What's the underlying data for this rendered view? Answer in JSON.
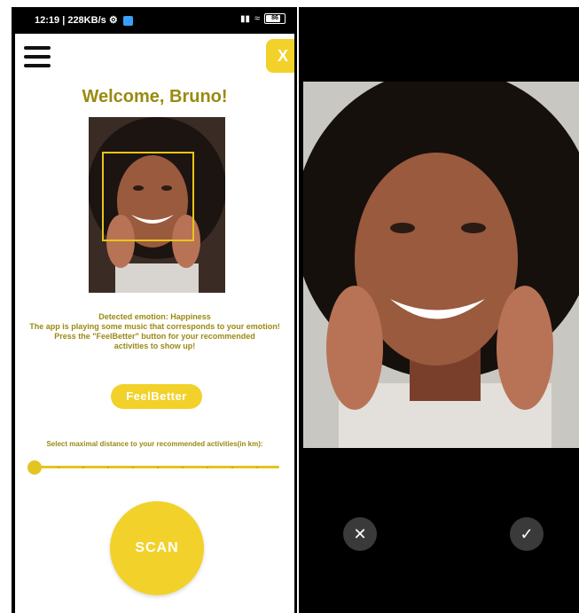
{
  "left_screen": {
    "status_bar": {
      "time": "12:19 | 228KB/s",
      "battery": "86"
    },
    "welcome": "Welcome, Bruno!",
    "close_label": "X",
    "emotion_lines": [
      "Detected emotion: Happiness",
      "The app is playing some music that corresponds to your emotion!",
      "Press the \"FeelBetter\" button for your recommended",
      "activities to show up!"
    ],
    "feelbetter_label": "FeelBetter",
    "slider_label": "Select maximal distance to your recommended activities(in km):",
    "slider_value_fraction": 0.0,
    "scan_label": "SCAN"
  },
  "right_screen": {
    "cancel_icon": "close-icon",
    "confirm_icon": "check-icon"
  },
  "colors": {
    "accent_yellow": "#f2d22a",
    "text_olive": "#9a8a12",
    "status_black": "#000000"
  }
}
